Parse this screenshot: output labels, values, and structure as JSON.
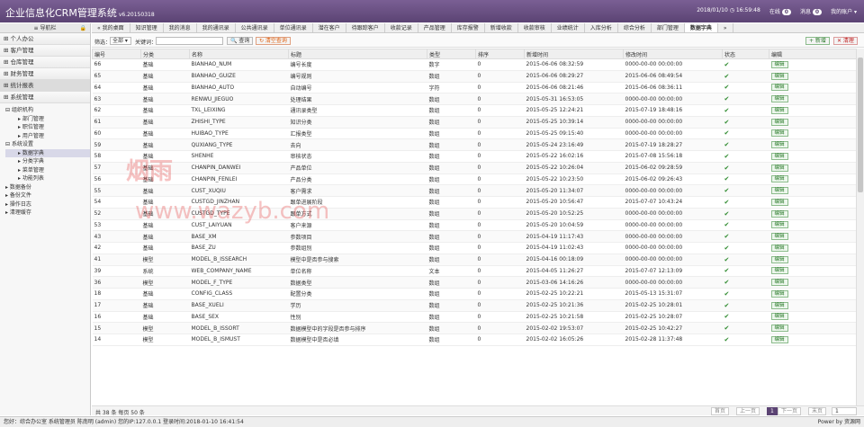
{
  "header": {
    "title": "企业信息化CRM管理系统",
    "version": "v6.20150318",
    "datetime": "2018/01/10 ◷ 16:59:48",
    "online_label": "在线",
    "online_count": "0",
    "msg_label": "消息",
    "msg_count": "0",
    "user": "我的账户 ▾"
  },
  "sidebar": {
    "title": "导航栏",
    "accordion": [
      "个人办公",
      "客户管理",
      "仓库管理",
      "财务管理",
      "统计报表",
      "系统管理"
    ],
    "tree": [
      "组织机构",
      "部门管理",
      "职位管理",
      "用户管理",
      "系统设置",
      "数据字典",
      "分类字典",
      "菜单管理",
      "功能列表",
      "数据备份",
      "备份文件",
      "操作日志",
      "清理缓存"
    ]
  },
  "tabs": [
    "« 我的桌面",
    "知识管理",
    "我的消息",
    "我的通讯录",
    "公共通讯录",
    "单位通讯录",
    "潜在客户",
    "待跟踪客户",
    "收款记录",
    "产品管理",
    "库存报警",
    "新增收款",
    "收款审核",
    "业绩统计",
    "入库分析",
    "综合分析",
    "部门管理",
    "数据字典",
    "»"
  ],
  "toolbar": {
    "category_label": "筛选：",
    "category_value": "全部 ▾",
    "keyword_label": "关键词：",
    "keyword_value": "",
    "search_btn": "🔍 查询",
    "clear_btn": "↻ 清空查询",
    "add_btn": "+ 新增",
    "del_btn": "✕ 清理"
  },
  "columns": [
    "编号",
    "分类",
    "名称",
    "标题",
    "类型",
    "排序",
    "新增时间",
    "修改时间",
    "状态",
    "编辑"
  ],
  "rows": [
    [
      "66",
      "基础",
      "BIANHAO_NUM",
      "编号长度",
      "数字",
      "0",
      "2015-06-06 08:32:59",
      "0000-00-00 00:00:00"
    ],
    [
      "65",
      "基础",
      "BIANHAO_GUIZE",
      "编号规则",
      "数组",
      "0",
      "2015-06-06 08:29:27",
      "2015-06-06 08:49:54"
    ],
    [
      "64",
      "基础",
      "BIANHAO_AUTO",
      "自动编号",
      "字符",
      "0",
      "2015-06-06 08:21:46",
      "2015-06-06 08:36:11"
    ],
    [
      "63",
      "基础",
      "RENWU_JIEGUO",
      "处理结果",
      "数组",
      "0",
      "2015-05-31 16:53:05",
      "0000-00-00 00:00:00"
    ],
    [
      "62",
      "基础",
      "TXL_LEIXING",
      "通讯录类型",
      "数组",
      "0",
      "2015-05-25 12:24:21",
      "2015-07-19 18:48:16"
    ],
    [
      "61",
      "基础",
      "ZHISHI_TYPE",
      "知识分类",
      "数组",
      "0",
      "2015-05-25 10:39:14",
      "0000-00-00 00:00:00"
    ],
    [
      "60",
      "基础",
      "HUIBAO_TYPE",
      "汇报类型",
      "数组",
      "0",
      "2015-05-25 09:15:40",
      "0000-00-00 00:00:00"
    ],
    [
      "59",
      "基础",
      "QUXIANG_TYPE",
      "去向",
      "数组",
      "0",
      "2015-05-24 23:16:49",
      "2015-07-19 18:28:27"
    ],
    [
      "58",
      "基础",
      "SHENHE",
      "审核状态",
      "数组",
      "0",
      "2015-05-22 16:02:16",
      "2015-07-08 15:56:18"
    ],
    [
      "57",
      "基础",
      "CHANPIN_DANWEI",
      "产品单位",
      "数组",
      "0",
      "2015-05-22 10:26:04",
      "2015-06-02 09:28:59"
    ],
    [
      "56",
      "基础",
      "CHANPIN_FENLEI",
      "产品分类",
      "数组",
      "0",
      "2015-05-22 10:23:50",
      "2015-06-02 09:26:43"
    ],
    [
      "55",
      "基础",
      "CUST_XUQIU",
      "客户需求",
      "数组",
      "0",
      "2015-05-20 11:34:07",
      "0000-00-00 00:00:00"
    ],
    [
      "54",
      "基础",
      "CUSTGD_JINZHAN",
      "跟单进展阶段",
      "数组",
      "0",
      "2015-05-20 10:56:47",
      "2015-07-07 10:43:24"
    ],
    [
      "52",
      "基础",
      "CUSTGD_TYPE",
      "跟单方式",
      "数组",
      "0",
      "2015-05-20 10:52:25",
      "0000-00-00 00:00:00"
    ],
    [
      "53",
      "基础",
      "CUST_LAIYUAN",
      "客户来源",
      "数组",
      "0",
      "2015-05-20 10:04:59",
      "0000-00-00 00:00:00"
    ],
    [
      "43",
      "基础",
      "BASE_XM",
      "参数项目",
      "数组",
      "0",
      "2015-04-19 11:17:43",
      "0000-00-00 00:00:00"
    ],
    [
      "42",
      "基础",
      "BASE_ZU",
      "参数组别",
      "数组",
      "0",
      "2015-04-19 11:02:43",
      "0000-00-00 00:00:00"
    ],
    [
      "41",
      "模型",
      "MODEL_B_ISSEARCH",
      "模型中是否参与搜索",
      "数组",
      "0",
      "2015-04-16 00:18:09",
      "0000-00-00 00:00:00"
    ],
    [
      "39",
      "系统",
      "WEB_COMPANY_NAME",
      "单位名称",
      "文本",
      "0",
      "2015-04-05 11:26:27",
      "2015-07-07 12:13:09"
    ],
    [
      "36",
      "模型",
      "MODEL_F_TYPE",
      "数据类型",
      "数组",
      "0",
      "2015-03-06 14:16:26",
      "0000-00-00 00:00:00"
    ],
    [
      "18",
      "基础",
      "CONFIG_CLASS",
      "配置分类",
      "数组",
      "0",
      "2015-02-25 10:22:21",
      "2015-05-13 15:31:07"
    ],
    [
      "17",
      "基础",
      "BASE_XUELI",
      "学历",
      "数组",
      "0",
      "2015-02-25 10:21:36",
      "2015-02-25 10:28:01"
    ],
    [
      "16",
      "基础",
      "BASE_SEX",
      "性别",
      "数组",
      "0",
      "2015-02-25 10:21:58",
      "2015-02-25 10:28:07"
    ],
    [
      "15",
      "模型",
      "MODEL_B_ISSORT",
      "数据模型中的字段是否参与排序",
      "数组",
      "0",
      "2015-02-02 19:53:07",
      "2015-02-25 10:42:27"
    ],
    [
      "14",
      "模型",
      "MODEL_B_ISMUST",
      "数据模型中是否必填",
      "数组",
      "0",
      "2015-02-02 16:05:26",
      "2015-02-28 11:37:48"
    ]
  ],
  "edit_label": "编辑",
  "pager": {
    "info": "共 38 条 每页 50 条",
    "first": "首页",
    "prev": "上一页",
    "current": "1",
    "next": "下一页",
    "last": "末页",
    "goto": "1"
  },
  "status": {
    "left": "您好：综合办公室 系统管理员 陈南明 (admin) 您的IP:127.0.0.1 登录时间:2018-01-10 16:41:54",
    "right": "Power by 资源网"
  },
  "watermark": {
    "line1": "烟雨",
    "line2": "www.wazyb.com"
  }
}
